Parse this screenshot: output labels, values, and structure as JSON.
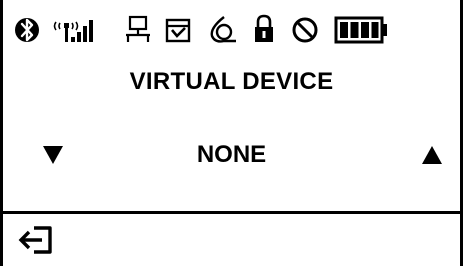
{
  "status_icons": [
    "bluetooth-icon",
    "wireless-signal-icon",
    "network-icon",
    "document-tray-icon",
    "media-roll-icon",
    "lock-icon",
    "prohibited-icon",
    "battery-icon"
  ],
  "battery": {
    "level": 1.0
  },
  "menu": {
    "title": "VIRTUAL DEVICE",
    "value": "NONE"
  },
  "colors": {
    "foreground": "#000000",
    "background": "#ffffff"
  }
}
